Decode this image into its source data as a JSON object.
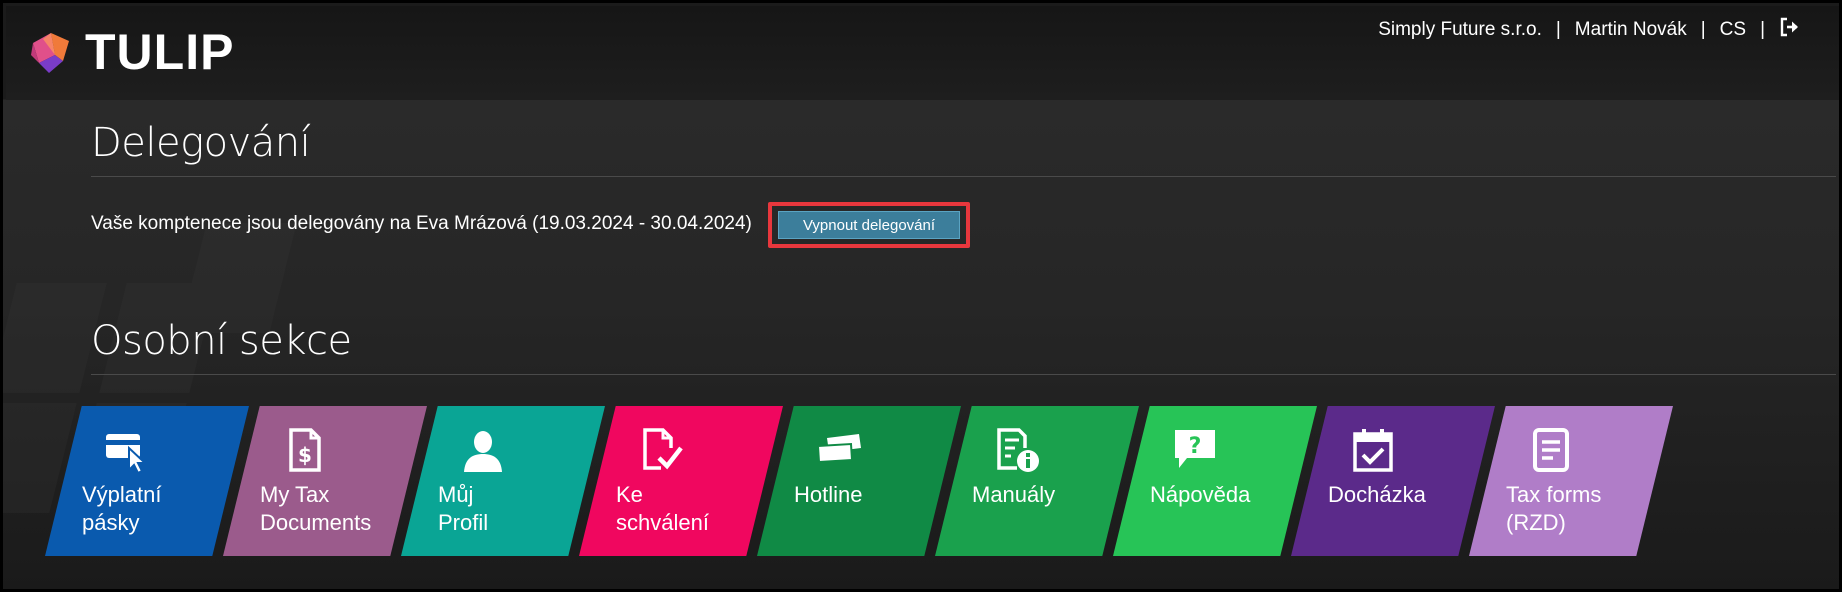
{
  "header": {
    "logo_text": "TULIP",
    "company": "Simply Future s.r.o.",
    "user": "Martin Novák",
    "language": "CS",
    "logout_icon": "logout-icon",
    "separator": "|"
  },
  "delegation": {
    "title": "Delegování",
    "message": "Vaše komptenece jsou delegovány na Eva Mrázová (19.03.2024 - 30.04.2024)",
    "button_label": "Vypnout delegování"
  },
  "personal": {
    "title": "Osobní sekce",
    "tiles": [
      {
        "label": "Výplatní\npásky",
        "icon": "payslip-card-click-icon",
        "color": "#0a5aae"
      },
      {
        "label": "My Tax\nDocuments",
        "icon": "tax-document-dollar-icon",
        "color": "#9b5b8c"
      },
      {
        "label": "Můj\nProfil",
        "icon": "user-profile-icon",
        "color": "#0aa595"
      },
      {
        "label": "Ke\nschválení",
        "icon": "document-check-icon",
        "color": "#f0075f"
      },
      {
        "label": "Hotline",
        "icon": "tickets-icon",
        "color": "#108a45"
      },
      {
        "label": "Manuály",
        "icon": "manual-info-icon",
        "color": "#1aa14d"
      },
      {
        "label": "Nápověda",
        "icon": "help-question-icon",
        "color": "#27c457"
      },
      {
        "label": "Docházka",
        "icon": "calendar-check-icon",
        "color": "#5b2a8a"
      },
      {
        "label": "Tax forms\n(RZD)",
        "icon": "tax-form-icon",
        "color": "#b07dc8"
      }
    ]
  }
}
